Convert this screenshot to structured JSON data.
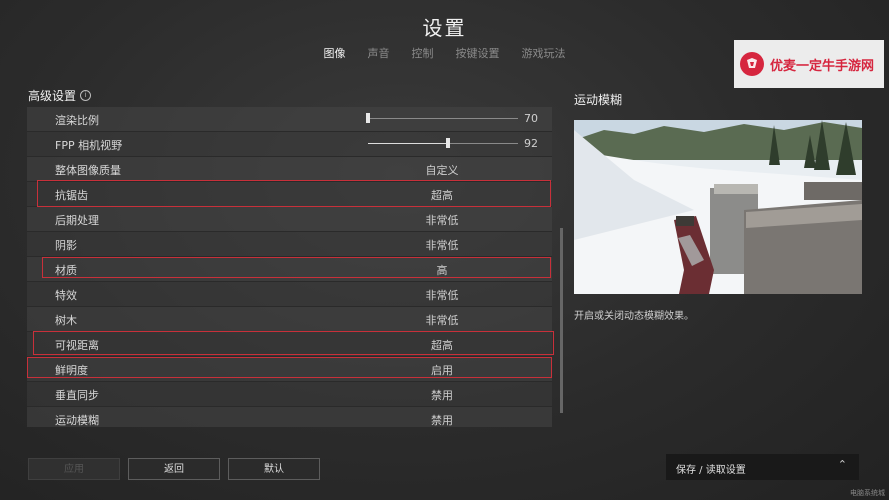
{
  "header": {
    "title": "设置"
  },
  "tabs": [
    {
      "label": "图像",
      "active": true
    },
    {
      "label": "声音"
    },
    {
      "label": "控制"
    },
    {
      "label": "按键设置"
    },
    {
      "label": "游戏玩法"
    }
  ],
  "watermark": {
    "text": "优麦一定牛手游网"
  },
  "section": {
    "title": "高级设置"
  },
  "settings": [
    {
      "label": "渲染比例",
      "slider": true,
      "value": "70",
      "fraction": 0.0
    },
    {
      "label": "FPP 相机视野",
      "slider": true,
      "value": "92",
      "fraction": 0.53
    },
    {
      "label": "整体图像质量",
      "value": "自定义"
    },
    {
      "label": "抗锯齿",
      "value": "超高",
      "highlighted": true
    },
    {
      "label": "后期处理",
      "value": "非常低"
    },
    {
      "label": "阴影",
      "value": "非常低"
    },
    {
      "label": "材质",
      "value": "高",
      "highlighted": true
    },
    {
      "label": "特效",
      "value": "非常低"
    },
    {
      "label": "树木",
      "value": "非常低"
    },
    {
      "label": "可视距离",
      "value": "超高",
      "highlighted": true
    },
    {
      "label": "鲜明度",
      "value": "启用",
      "highlighted": true
    },
    {
      "label": "垂直同步",
      "value": "禁用"
    },
    {
      "label": "运动模糊",
      "value": "禁用"
    }
  ],
  "detail": {
    "title": "运动模糊",
    "description": "开启或关闭动态模糊效果。"
  },
  "buttons": {
    "apply": "应用",
    "back": "返回",
    "default": "默认"
  },
  "save_load": {
    "label": "保存 / 读取设置"
  },
  "corner_text": "电脑系统城",
  "colors": {
    "highlight": "#c8303a",
    "accent": "#d6263f"
  }
}
